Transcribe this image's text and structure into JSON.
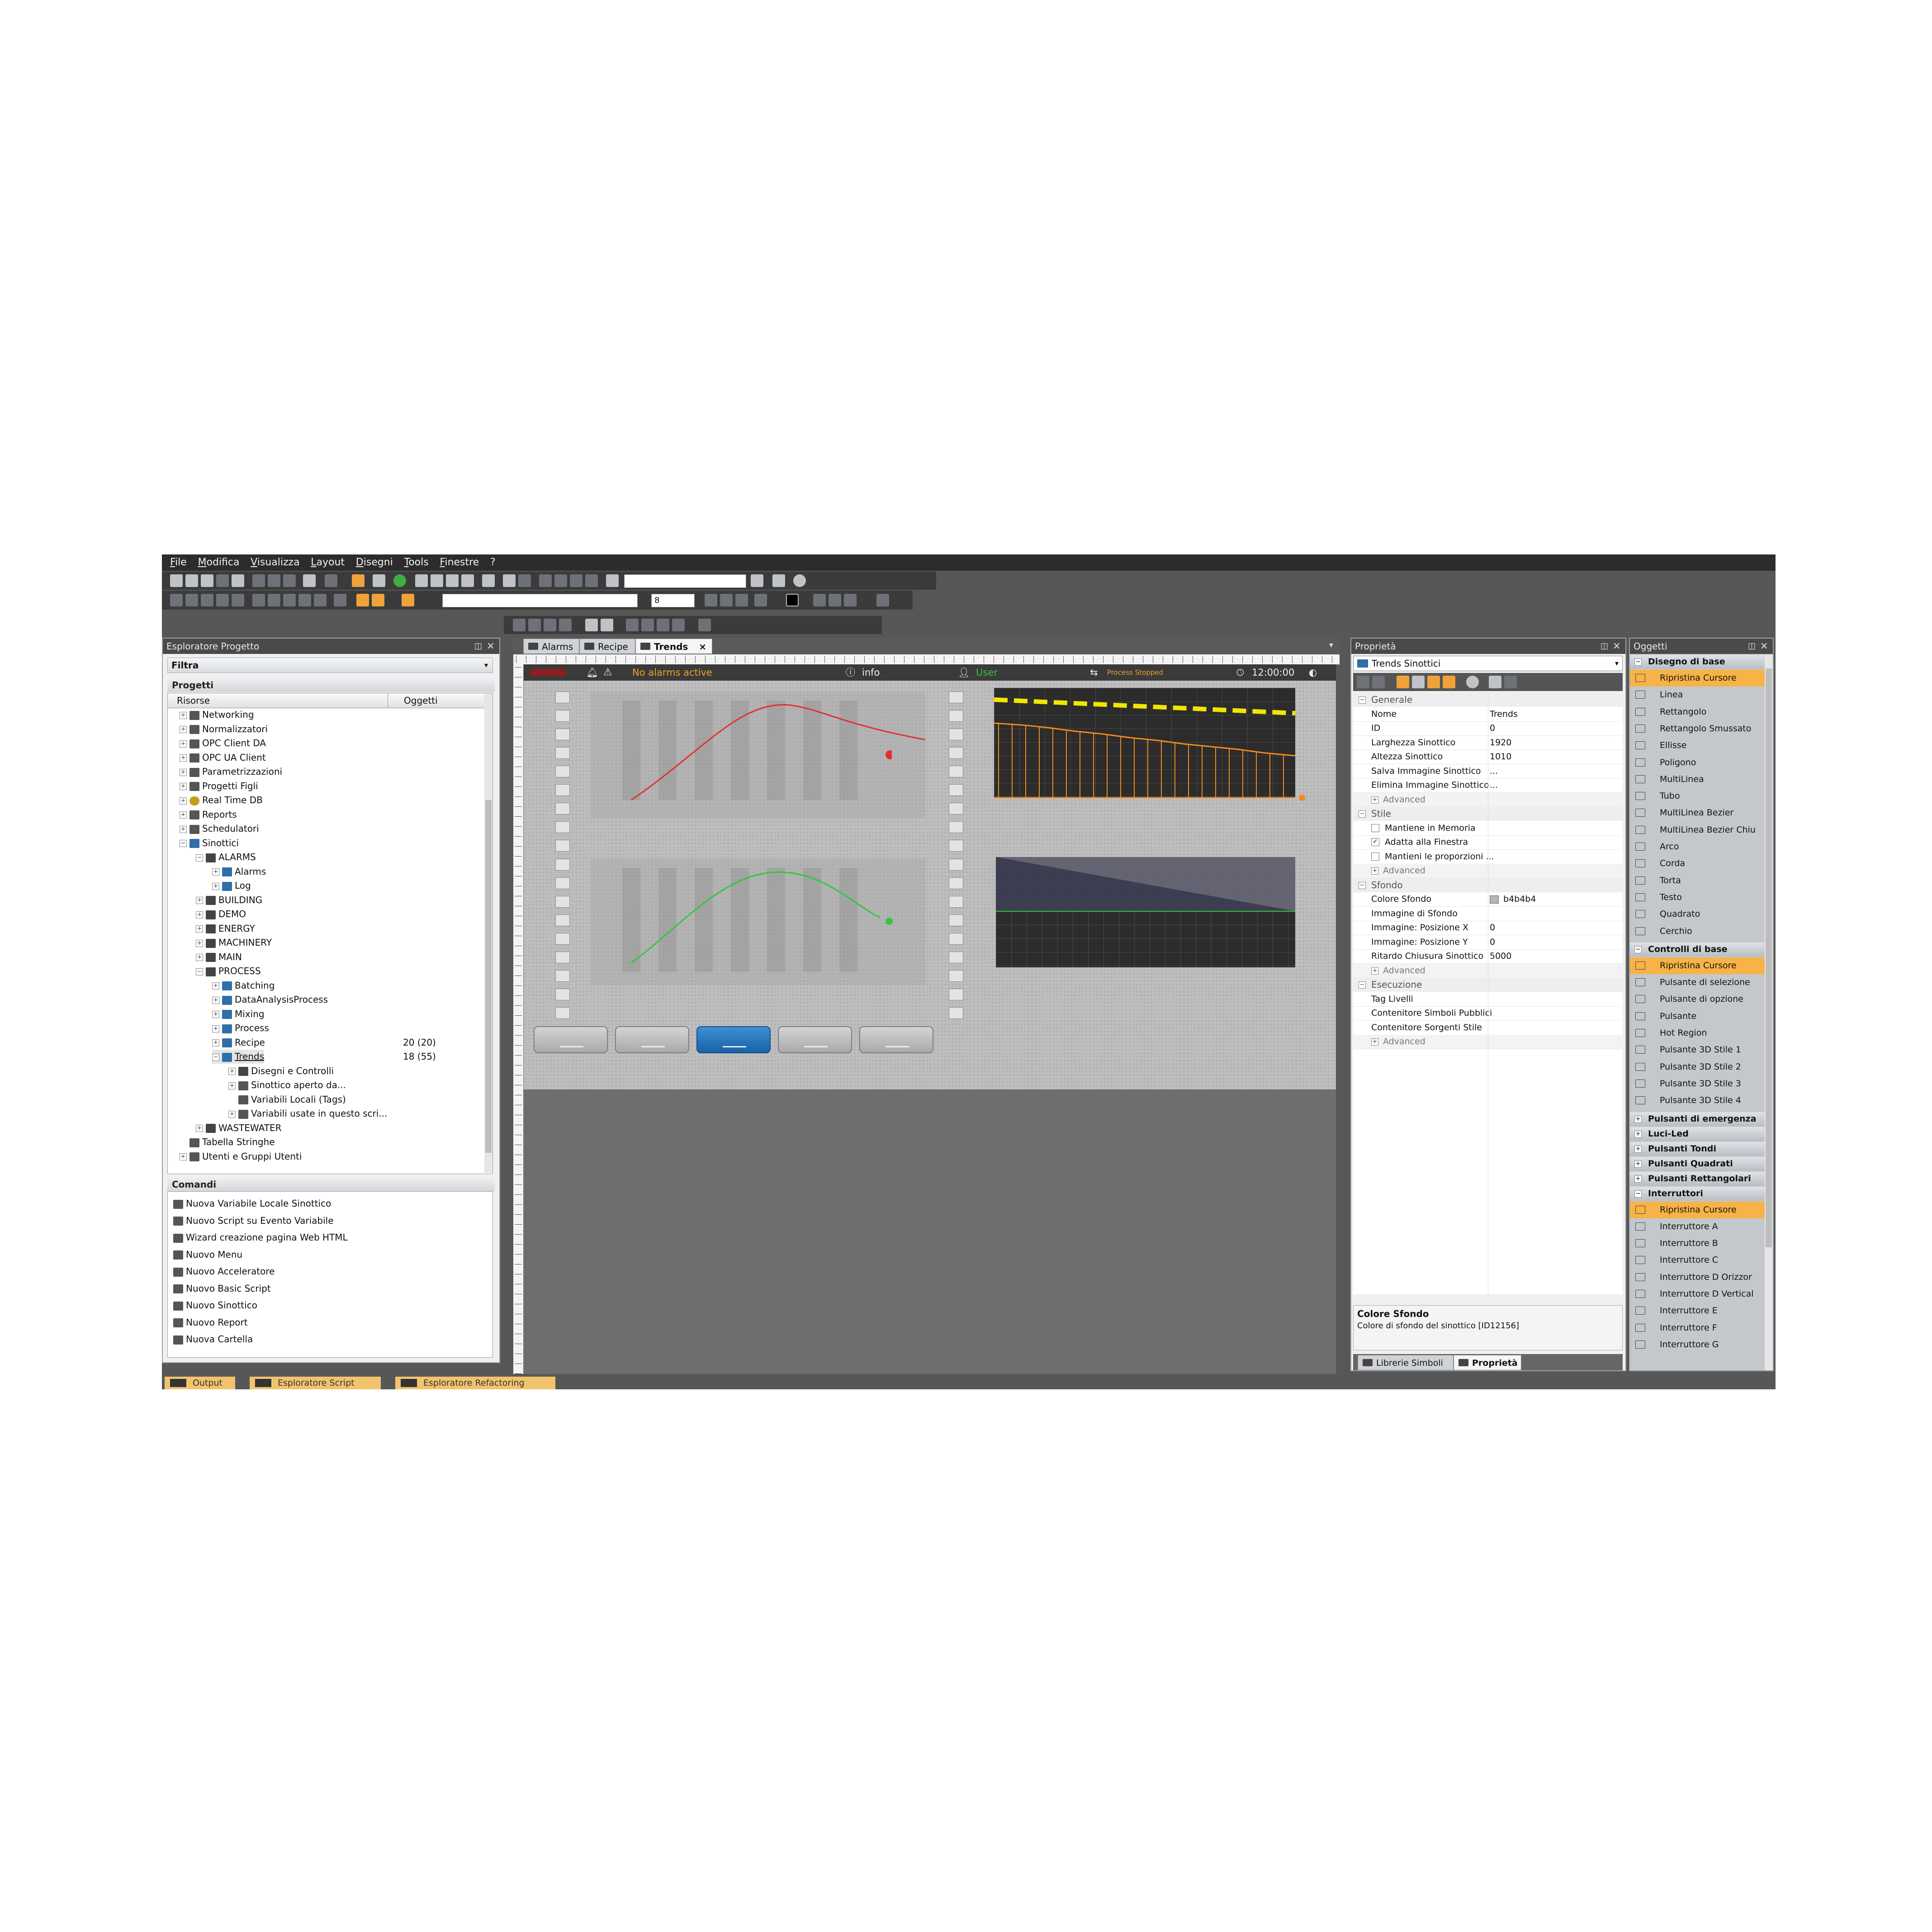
{
  "menu": [
    "File",
    "Modifica",
    "Visualizza",
    "Layout",
    "Disegni",
    "Tools",
    "Finestre",
    "?"
  ],
  "toolbar": {
    "font_size": "8"
  },
  "project_explorer": {
    "title": "Esploratore Progetto",
    "filter_label": "Filtra",
    "section_projects": "Progetti",
    "col_resources": "Risorse",
    "col_objects": "Oggetti",
    "tree": [
      {
        "label": "Networking",
        "depth": 1,
        "exp": "+",
        "icon": "gen"
      },
      {
        "label": "Normalizzatori",
        "depth": 1,
        "exp": "+",
        "icon": "gen"
      },
      {
        "label": "OPC Client DA",
        "depth": 1,
        "exp": "+",
        "icon": "gen"
      },
      {
        "label": "OPC UA Client",
        "depth": 1,
        "exp": "+",
        "icon": "gen"
      },
      {
        "label": "Parametrizzazioni",
        "depth": 1,
        "exp": "+",
        "icon": "gen"
      },
      {
        "label": "Progetti Figli",
        "depth": 1,
        "exp": "+",
        "icon": "gen"
      },
      {
        "label": "Real Time DB",
        "depth": 1,
        "exp": "+",
        "icon": "gear"
      },
      {
        "label": "Reports",
        "depth": 1,
        "exp": "+",
        "icon": "gen"
      },
      {
        "label": "Schedulatori",
        "depth": 1,
        "exp": "+",
        "icon": "gen"
      },
      {
        "label": "Sinottici",
        "depth": 1,
        "exp": "−",
        "icon": "screen"
      },
      {
        "label": "ALARMS",
        "depth": 2,
        "exp": "−",
        "icon": "folder"
      },
      {
        "label": "Alarms",
        "depth": 3,
        "exp": "+",
        "icon": "screen"
      },
      {
        "label": "Log",
        "depth": 3,
        "exp": "+",
        "icon": "screen"
      },
      {
        "label": "BUILDING",
        "depth": 2,
        "exp": "+",
        "icon": "folder"
      },
      {
        "label": "DEMO",
        "depth": 2,
        "exp": "+",
        "icon": "folder"
      },
      {
        "label": "ENERGY",
        "depth": 2,
        "exp": "+",
        "icon": "folder"
      },
      {
        "label": "MACHINERY",
        "depth": 2,
        "exp": "+",
        "icon": "folder"
      },
      {
        "label": "MAIN",
        "depth": 2,
        "exp": "+",
        "icon": "folder"
      },
      {
        "label": "PROCESS",
        "depth": 2,
        "exp": "−",
        "icon": "folder"
      },
      {
        "label": "Batching",
        "depth": 3,
        "exp": "+",
        "icon": "screen"
      },
      {
        "label": "DataAnalysisProcess",
        "depth": 3,
        "exp": "+",
        "icon": "screen"
      },
      {
        "label": "Mixing",
        "depth": 3,
        "exp": "+",
        "icon": "screen"
      },
      {
        "label": "Process",
        "depth": 3,
        "exp": "+",
        "icon": "screen"
      },
      {
        "label": "Recipe",
        "depth": 3,
        "exp": "+",
        "icon": "screen",
        "objects": "20 (20)"
      },
      {
        "label": "Trends",
        "depth": 3,
        "exp": "−",
        "icon": "screen",
        "objects": "18 (55)",
        "selected": true
      },
      {
        "label": "Disegni e Controlli",
        "depth": 4,
        "exp": "+",
        "icon": "folder"
      },
      {
        "label": "Sinottico aperto da...",
        "depth": 4,
        "exp": "+",
        "icon": "gen"
      },
      {
        "label": "Variabili Locali (Tags)",
        "depth": 4,
        "exp": "",
        "icon": "gen"
      },
      {
        "label": "Variabili usate in questo scri...",
        "depth": 4,
        "exp": "+",
        "icon": "gen"
      },
      {
        "label": "WASTEWATER",
        "depth": 2,
        "exp": "+",
        "icon": "folder"
      },
      {
        "label": "Tabella Stringhe",
        "depth": 1,
        "exp": "",
        "icon": "gen"
      },
      {
        "label": "Utenti e Gruppi Utenti",
        "depth": 1,
        "exp": "+",
        "icon": "gen"
      }
    ],
    "commands_title": "Comandi",
    "commands": [
      "Nuova Variabile Locale Sinottico",
      "Nuovo Script su Evento Variabile",
      "Wizard creazione pagina Web HTML",
      "Nuovo Menu",
      "Nuovo Acceleratore",
      "Nuovo Basic Script",
      "Nuovo Sinottico",
      "Nuovo Report",
      "Nuova Cartella"
    ]
  },
  "editor": {
    "tabs": [
      {
        "label": "Alarms"
      },
      {
        "label": "Recipe"
      },
      {
        "label": "Trends",
        "active": true
      }
    ],
    "close_glyph": "×",
    "header": {
      "alarms_label": "No alarms active",
      "info_label": "info",
      "user_label": "User",
      "process_label": "Process Stopped",
      "time": "12:00:00"
    }
  },
  "properties": {
    "title": "Proprietà",
    "object": "Trends Sinottici",
    "categories": {
      "general": "Generale",
      "style": "Stile",
      "background": "Sfondo",
      "execution": "Esecuzione"
    },
    "advanced": "Advanced",
    "general_rows": [
      {
        "k": "Nome",
        "v": "Trends"
      },
      {
        "k": "ID",
        "v": "0"
      },
      {
        "k": "Larghezza Sinottico",
        "v": "1920"
      },
      {
        "k": "Altezza Sinottico",
        "v": "1010"
      },
      {
        "k": "Salva Immagine Sinottico",
        "v": "..."
      },
      {
        "k": "Elimina Immagine Sinottico",
        "v": "..."
      }
    ],
    "style_rows": [
      {
        "k": "Mantiene in Memoria",
        "checked": false
      },
      {
        "k": "Adatta alla Finestra",
        "checked": true
      },
      {
        "k": "Mantieni le proporzioni ...",
        "checked": false
      }
    ],
    "background_rows": [
      {
        "k": "Colore Sfondo",
        "v": "b4b4b4"
      },
      {
        "k": "Immagine di Sfondo",
        "v": ""
      },
      {
        "k": "Immagine: Posizione X",
        "v": "0"
      },
      {
        "k": "Immagine: Posizione Y",
        "v": "0"
      },
      {
        "k": "Ritardo Chiusura Sinottico",
        "v": "5000"
      }
    ],
    "execution_rows": [
      {
        "k": "Tag Livelli",
        "v": ""
      },
      {
        "k": "Contenitore Simboli Pubblici",
        "v": ""
      },
      {
        "k": "Contenitore Sorgenti Stile",
        "v": ""
      }
    ],
    "desc_title": "Colore Sfondo",
    "desc_text": "Colore di sfondo del sinottico [ID12156]",
    "bottom_tabs": [
      "Librerie Simboli",
      "Proprietà"
    ]
  },
  "objects": {
    "title": "Oggetti",
    "sections": [
      {
        "label": "Disegno di base",
        "items": [
          "Ripristina Cursore",
          "Linea",
          "Rettangolo",
          "Rettangolo Smussato",
          "Ellisse",
          "Poligono",
          "MultiLinea",
          "Tubo",
          "MultiLinea Bezier",
          "MultiLinea Bezier Chiu",
          "Arco",
          "Corda",
          "Torta",
          "Testo",
          "Quadrato",
          "Cerchio"
        ]
      },
      {
        "label": "Controlli di base",
        "items": [
          "Ripristina Cursore",
          "Pulsante di selezione",
          "Pulsante di opzione",
          "Pulsante",
          "Hot Region",
          "Pulsante 3D Stile 1",
          "Pulsante 3D Stile 2",
          "Pulsante 3D Stile 3",
          "Pulsante 3D Stile 4"
        ]
      },
      {
        "label": "Pulsanti di emergenza",
        "items": []
      },
      {
        "label": "Luci-Led",
        "items": []
      },
      {
        "label": "Pulsanti Tondi",
        "items": []
      },
      {
        "label": "Pulsanti Quadrati",
        "items": []
      },
      {
        "label": "Pulsanti Rettangolari",
        "items": []
      },
      {
        "label": "Interruttori",
        "items": [
          "Ripristina Cursore",
          "Interruttore A",
          "Interruttore B",
          "Interruttore C",
          "Interruttore D Orizzor",
          "Interruttore D Vertical",
          "Interruttore E",
          "Interruttore F",
          "Interruttore G"
        ]
      }
    ]
  },
  "bottom_tabs": [
    "Output",
    "Esploratore Script",
    "Esploratore Refactoring"
  ],
  "colors": {
    "accent": "#f7b347",
    "active_button": "#2a79c4",
    "trend_red": "#e03030",
    "trend_green": "#2ec93a",
    "trend_yellow": "#f2e600",
    "trend_orange": "#f28a1e"
  }
}
